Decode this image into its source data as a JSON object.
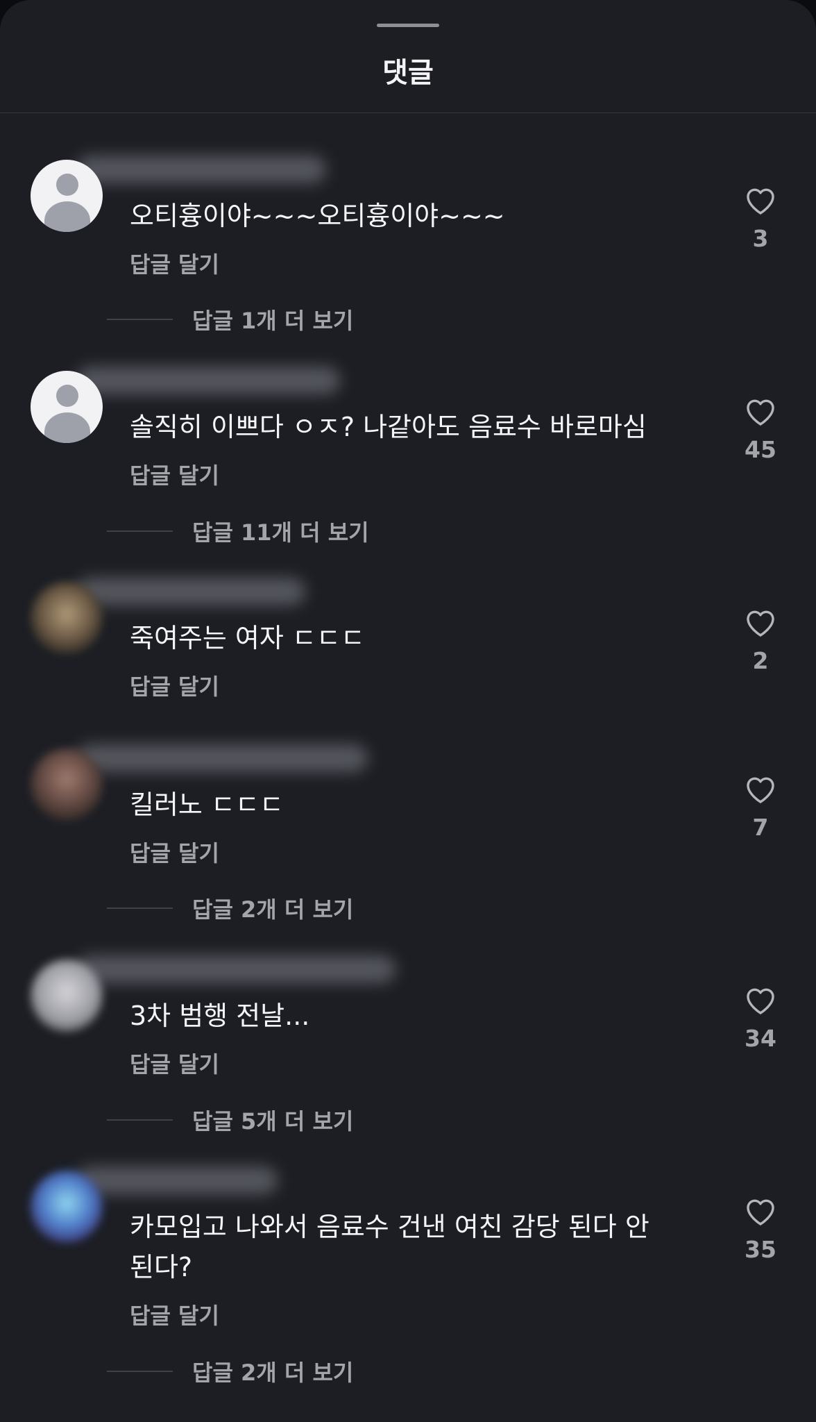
{
  "header": {
    "title": "댓글"
  },
  "colors": {
    "background": "#1c1e24",
    "text_primary": "#f4f5f7",
    "text_secondary": "#a3a5ab",
    "divider": "#34363d"
  },
  "comments": [
    {
      "text": "오티흉이야~~~오티흉이야~~~",
      "reply_label": "답글 달기",
      "likes": "3",
      "view_replies": "답글 1개 더 보기",
      "avatar": "default-profile-icon"
    },
    {
      "text": "솔직히 이쁘다 ㅇㅈ? 나같아도 음료수 바로마심",
      "reply_label": "답글 달기",
      "likes": "45",
      "view_replies": "답글 11개 더 보기",
      "avatar": "default-profile-icon"
    },
    {
      "text": "죽여주는 여자 ㄷㄷㄷ",
      "reply_label": "답글 달기",
      "likes": "2",
      "avatar": "blurred-photo"
    },
    {
      "text": "킬러노 ㄷㄷㄷ",
      "reply_label": "답글 달기",
      "likes": "7",
      "view_replies": "답글 2개 더 보기",
      "avatar": "blurred-photo"
    },
    {
      "text": "3차 범행 전날...",
      "reply_label": "답글 달기",
      "likes": "34",
      "view_replies": "답글 5개 더 보기",
      "avatar": "blurred-photo"
    },
    {
      "text": "카모입고 나와서 음료수 건낸 여친 감당 된다 안된다?",
      "reply_label": "답글 달기",
      "likes": "35",
      "view_replies": "답글 2개 더 보기",
      "avatar": "blurred-photo"
    }
  ]
}
